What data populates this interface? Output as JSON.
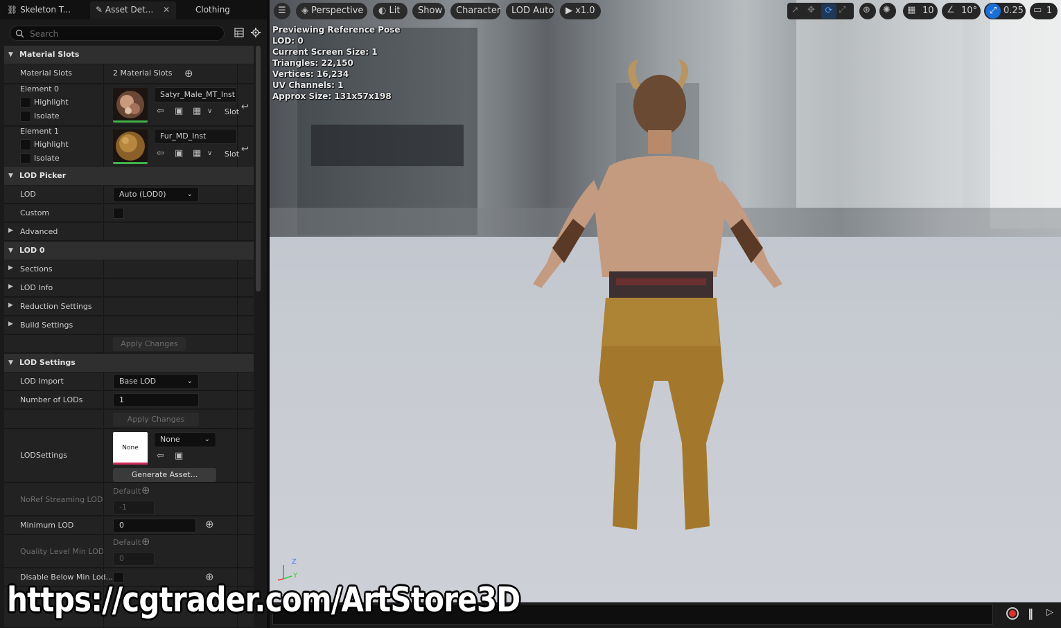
{
  "tabs": [
    {
      "label": "Skeleton T...",
      "icon": "skeleton-icon"
    },
    {
      "label": "Asset Det...",
      "icon": "brush-icon",
      "close": "✕"
    },
    {
      "label": "Clothing"
    }
  ],
  "search": {
    "placeholder": "Search"
  },
  "material_slots": {
    "header": "Material Slots",
    "row_label": "Material Slots",
    "count_text": "2 Material Slots",
    "elements": [
      {
        "label": "Element 0",
        "highlight": "Highlight",
        "isolate": "Isolate",
        "material": "Satyr_Male_MT_Inst",
        "slot": "Slot"
      },
      {
        "label": "Element 1",
        "highlight": "Highlight",
        "isolate": "Isolate",
        "material": "Fur_MD_Inst",
        "slot": "Slot"
      }
    ]
  },
  "lod_picker": {
    "header": "LOD Picker",
    "lod_label": "LOD",
    "lod_value": "Auto (LOD0)",
    "custom_label": "Custom",
    "advanced_label": "Advanced"
  },
  "lod0": {
    "header": "LOD 0",
    "items": [
      "Sections",
      "LOD Info",
      "Reduction Settings",
      "Build Settings"
    ],
    "apply": "Apply Changes"
  },
  "lod_settings": {
    "header": "LOD Settings",
    "lod_import_label": "LOD Import",
    "lod_import_value": "Base LOD",
    "num_lods_label": "Number of LODs",
    "num_lods_value": "1",
    "apply": "Apply Changes",
    "lodsettings_label": "LODSettings",
    "thumb_text": "None",
    "asset_value": "None",
    "generate": "Generate Asset...",
    "noref_label": "NoRef Streaming LOD B",
    "noref_default": "Default",
    "noref_value": "-1",
    "min_lod_label": "Minimum LOD",
    "min_lod_value": "0",
    "quality_label": "Quality Level Min LOD",
    "quality_default": "Default",
    "quality_value": "0",
    "disable_label": "Disable Below Min Lod..."
  },
  "viewport": {
    "toolbar": {
      "perspective": "Perspective",
      "lit": "Lit",
      "show": "Show",
      "character": "Character",
      "lod": "LOD Auto",
      "speed": "x1.0",
      "grid": "10",
      "angle": "10°",
      "scale": "0.25",
      "camera": "1"
    },
    "stats": [
      "Previewing Reference Pose",
      "LOD: 0",
      "Current Screen Size: 1",
      "Triangles: 22,150",
      "Vertices: 16,234",
      "UV Channels: 1",
      "Approx Size: 131x57x198"
    ],
    "axis": {
      "z": "Z",
      "y": "Y"
    }
  },
  "watermark": "https://cgtrader.com/ArtStore3D",
  "colors": {
    "accent": "#1a6fd6",
    "green_bar": "#3fb34a",
    "pink_bar": "#d02a5a",
    "record": "#e0302a"
  }
}
